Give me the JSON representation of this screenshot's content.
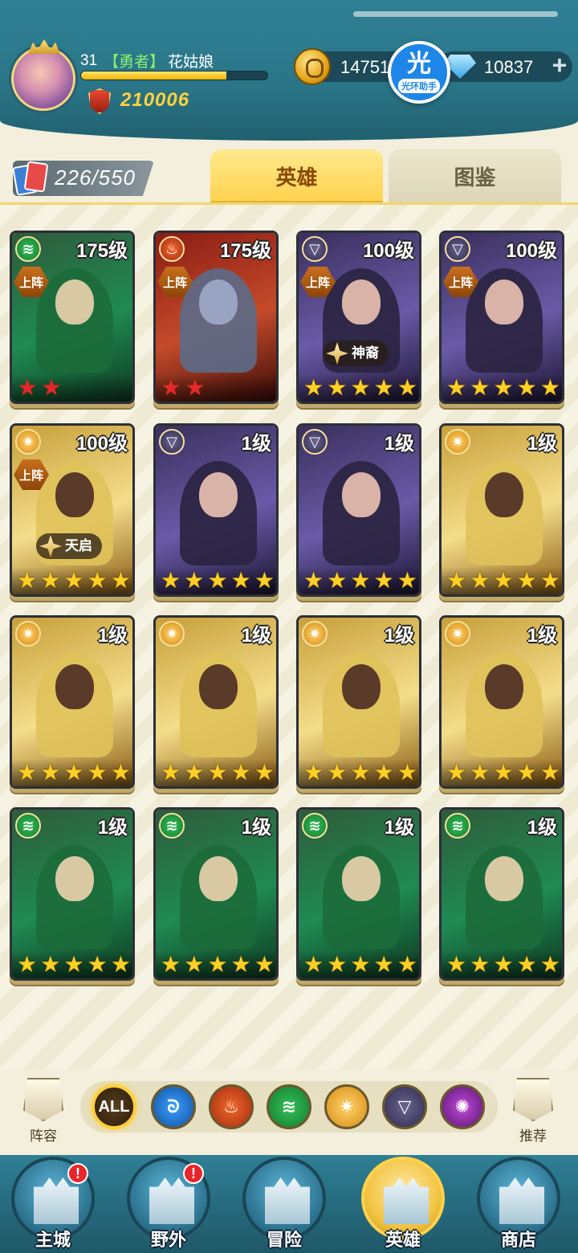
{
  "player": {
    "level": "31",
    "title_tag": "【勇者】",
    "name": "花姑娘",
    "xp_fraction": 0.78,
    "power": "210006"
  },
  "currency": {
    "gold": "14751",
    "gems": "10837",
    "plus": "+"
  },
  "helper": {
    "char": "光",
    "label": "光环助手"
  },
  "hero_count": "226/550",
  "tabs": [
    {
      "label": "英雄",
      "active": true
    },
    {
      "label": "图鉴",
      "active": false
    }
  ],
  "heroes": [
    {
      "level": "175级",
      "faction": "wind",
      "deployed": "上阵",
      "tag": "",
      "stars": 2,
      "star_color": "red"
    },
    {
      "level": "175级",
      "faction": "fire",
      "deployed": "上阵",
      "tag": "",
      "stars": 2,
      "star_color": "red"
    },
    {
      "level": "100级",
      "faction": "dark",
      "deployed": "上阵",
      "tag": "神裔",
      "stars": 5,
      "star_color": "gold"
    },
    {
      "level": "100级",
      "faction": "dark",
      "deployed": "上阵",
      "tag": "",
      "stars": 5,
      "star_color": "gold"
    },
    {
      "level": "100级",
      "faction": "light",
      "deployed": "上阵",
      "tag": "天启",
      "stars": 5,
      "star_color": "gold"
    },
    {
      "level": "1级",
      "faction": "dark",
      "deployed": "",
      "tag": "",
      "stars": 5,
      "star_color": "gold"
    },
    {
      "level": "1级",
      "faction": "dark",
      "deployed": "",
      "tag": "",
      "stars": 5,
      "star_color": "gold"
    },
    {
      "level": "1级",
      "faction": "light",
      "deployed": "",
      "tag": "",
      "stars": 5,
      "star_color": "gold"
    },
    {
      "level": "1级",
      "faction": "light",
      "deployed": "",
      "tag": "",
      "stars": 5,
      "star_color": "gold"
    },
    {
      "level": "1级",
      "faction": "light",
      "deployed": "",
      "tag": "",
      "stars": 5,
      "star_color": "gold"
    },
    {
      "level": "1级",
      "faction": "light",
      "deployed": "",
      "tag": "",
      "stars": 5,
      "star_color": "gold"
    },
    {
      "level": "1级",
      "faction": "light",
      "deployed": "",
      "tag": "",
      "stars": 5,
      "star_color": "gold"
    },
    {
      "level": "1级",
      "faction": "wind",
      "deployed": "",
      "tag": "",
      "stars": 5,
      "star_color": "gold"
    },
    {
      "level": "1级",
      "faction": "wind",
      "deployed": "",
      "tag": "",
      "stars": 5,
      "star_color": "gold"
    },
    {
      "level": "1级",
      "faction": "wind",
      "deployed": "",
      "tag": "",
      "stars": 5,
      "star_color": "gold"
    },
    {
      "level": "1级",
      "faction": "wind",
      "deployed": "",
      "tag": "",
      "stars": 5,
      "star_color": "gold"
    }
  ],
  "filters": {
    "lineup_label": "阵容",
    "recommend_label": "推荐",
    "all_label": "ALL",
    "factions": [
      "water",
      "fire",
      "wind",
      "light",
      "dark",
      "void"
    ]
  },
  "nav": [
    {
      "label": "主城",
      "alert": "!"
    },
    {
      "label": "野外",
      "alert": "!"
    },
    {
      "label": "冒险",
      "alert": ""
    },
    {
      "label": "英雄",
      "alert": ""
    },
    {
      "label": "商店",
      "alert": ""
    }
  ],
  "colors": {
    "topbar": "#2f7f95",
    "tab_active": "#ffd24e",
    "power_text": "#ffd23a",
    "title_tag": "#8df06b",
    "star_gold": "#ffcf24",
    "star_red": "#e8262b"
  }
}
